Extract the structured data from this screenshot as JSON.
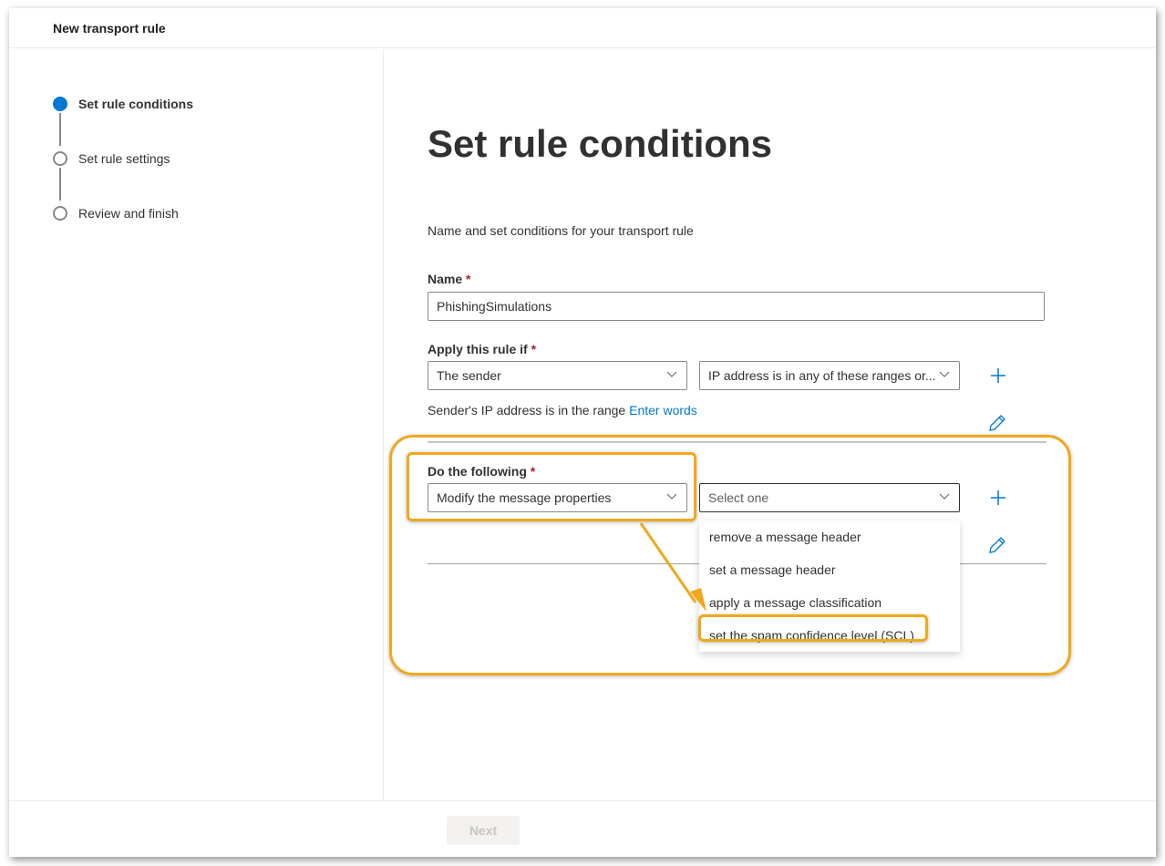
{
  "window": {
    "title": "New transport rule"
  },
  "steps": [
    {
      "label": "Set rule conditions",
      "state": "active"
    },
    {
      "label": "Set rule settings",
      "state": "pending"
    },
    {
      "label": "Review and finish",
      "state": "pending"
    }
  ],
  "main": {
    "title": "Set rule conditions",
    "subtitle": "Name and set conditions for your transport rule",
    "name_field": {
      "label": "Name",
      "required_mark": "*",
      "value": "PhishingSimulations"
    },
    "apply_rule": {
      "label": "Apply this rule if",
      "required_mark": "*",
      "condition": "The sender",
      "sub_condition": "IP address is in any of these ranges or...",
      "description_prefix": "Sender's IP address is in the range",
      "description_link": "Enter words"
    },
    "do_following": {
      "label": "Do the following",
      "required_mark": "*",
      "action": "Modify the message properties",
      "sub_action_placeholder": "Select one",
      "options": [
        "remove a message header",
        "set a message header",
        "apply a message classification",
        "set the spam confidence level (SCL)"
      ],
      "highlighted_option": "set the spam confidence level (SCL)"
    }
  },
  "footer": {
    "next_label": "Next",
    "next_enabled": false
  },
  "colors": {
    "accent": "#0078d4",
    "highlight": "#f0a81c",
    "required": "#a4262c"
  }
}
